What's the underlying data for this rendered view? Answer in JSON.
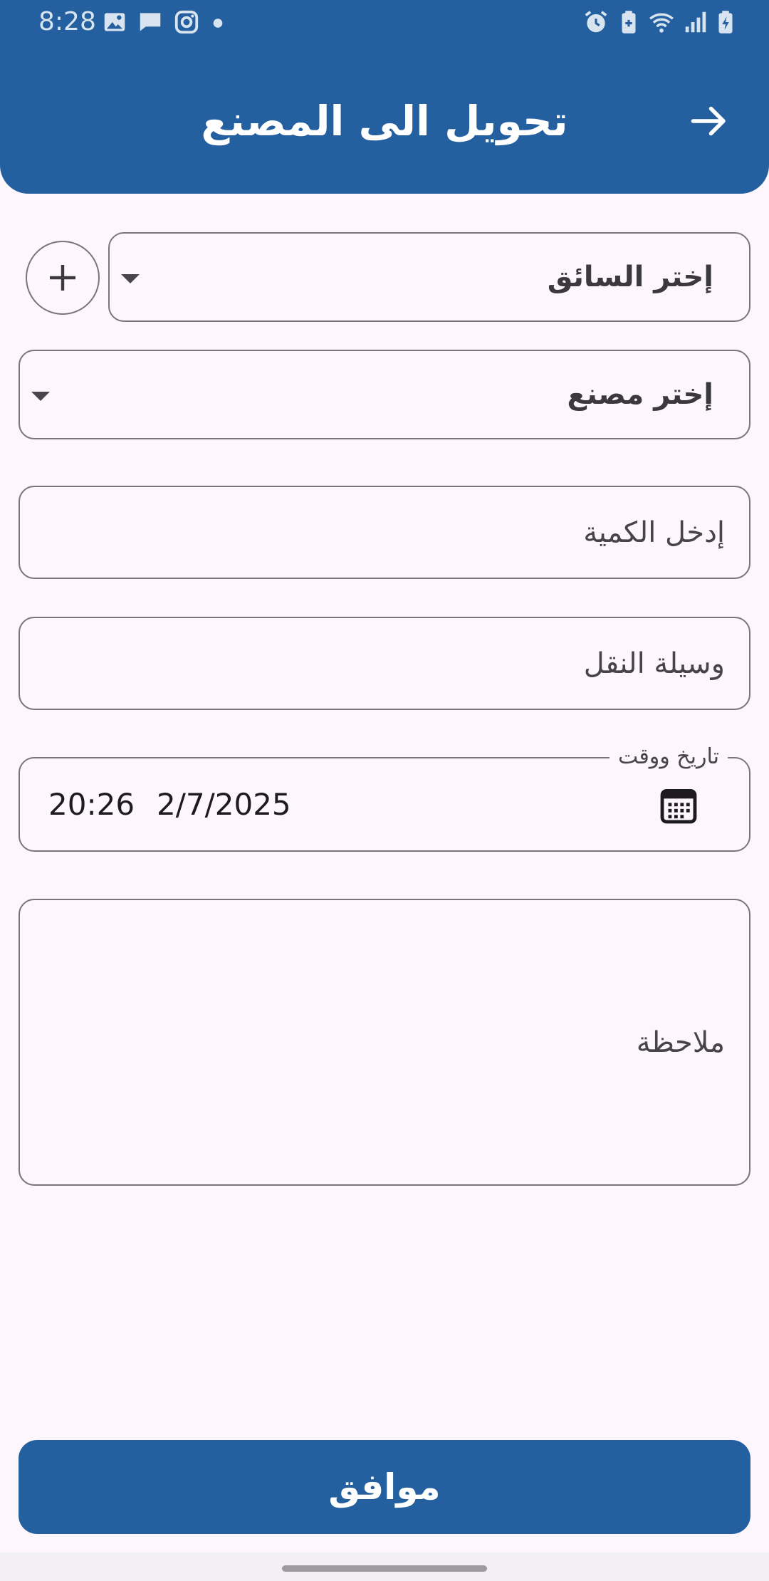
{
  "status_bar": {
    "time": "8:28",
    "left_icons": [
      "image-icon",
      "message-icon",
      "instagram-icon",
      "dot-icon"
    ],
    "right_icons": [
      "alarm-icon",
      "battery-saver-icon",
      "wifi-icon",
      "signal-icon",
      "battery-charging-icon"
    ]
  },
  "header": {
    "title": "تحويل الى المصنع",
    "back_icon": "arrow-right-icon"
  },
  "form": {
    "driver_select": {
      "placeholder": "إختر السائق",
      "icon": "dropdown-arrow-icon"
    },
    "add_driver": {
      "icon": "plus-icon"
    },
    "factory_select": {
      "placeholder": "إختر مصنع",
      "icon": "dropdown-arrow-icon"
    },
    "quantity_input": {
      "placeholder": "إدخل الكمية"
    },
    "transport_input": {
      "placeholder": "وسيلة النقل"
    },
    "datetime": {
      "label": "تاريخ ووقت",
      "date": "2/7/2025",
      "time": "20:26",
      "icon": "calendar-icon"
    },
    "note_input": {
      "placeholder": "ملاحظة"
    }
  },
  "submit": {
    "label": "موافق"
  },
  "colors": {
    "primary": "#24609f",
    "background": "#fdf7fd",
    "outline": "#7a7579"
  }
}
